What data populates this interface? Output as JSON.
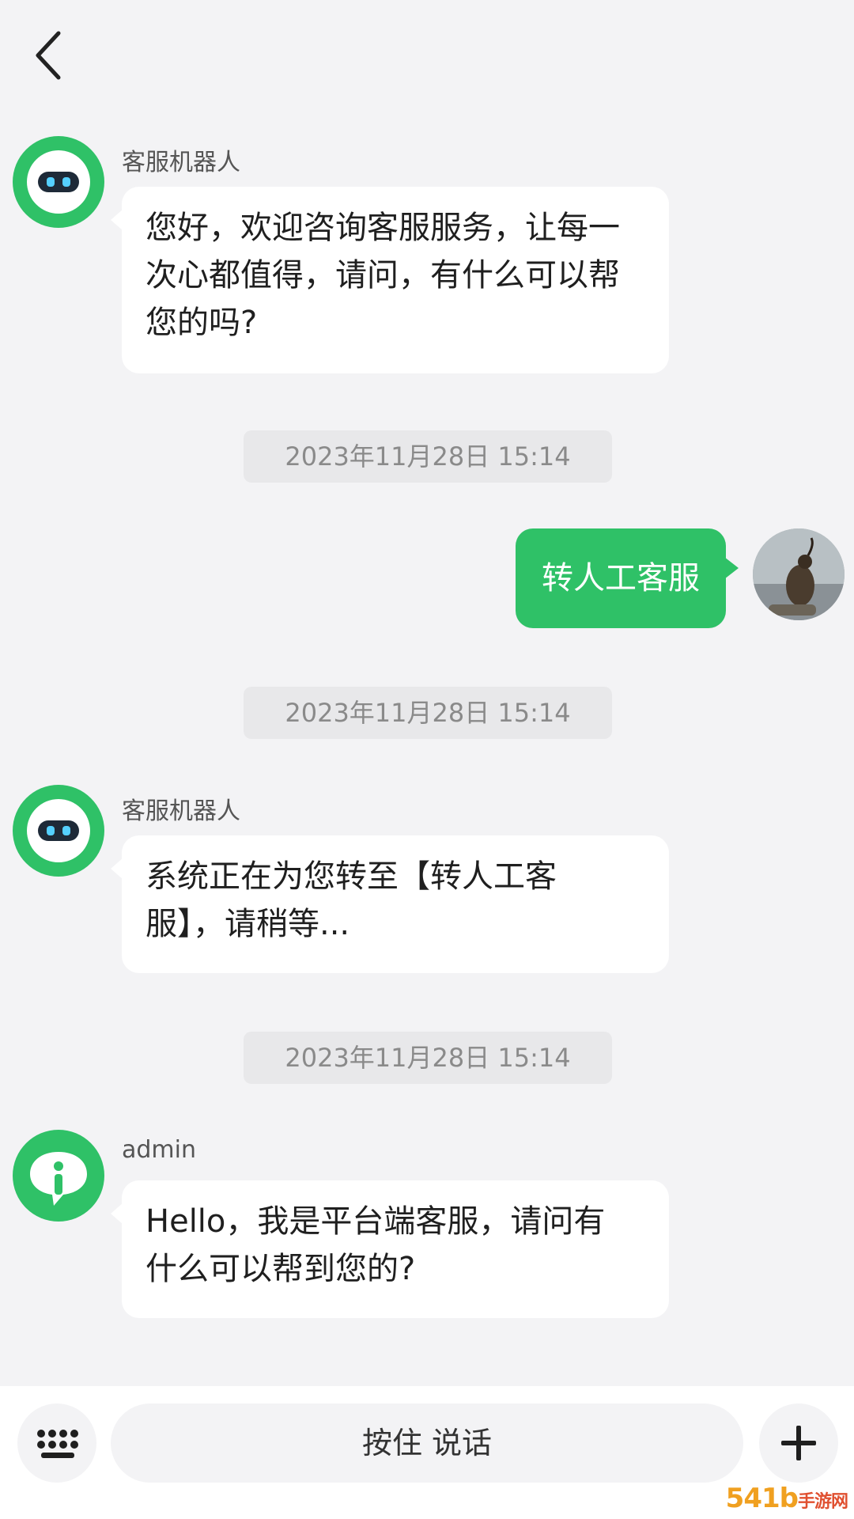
{
  "header": {
    "back_icon": "chevron-left-icon"
  },
  "messages": [
    {
      "type": "incoming",
      "sender": "客服机器人",
      "avatar": "robot-avatar",
      "lines": [
        "您好，欢迎咨询客服服务，让每一",
        "次心都值得，请问，有什么可以帮",
        "您的吗?"
      ]
    },
    {
      "type": "timestamp",
      "text": "2023年11月28日 15:14"
    },
    {
      "type": "outgoing",
      "text": "转人工客服",
      "avatar": "bird-avatar"
    },
    {
      "type": "timestamp",
      "text": "2023年11月28日 15:14"
    },
    {
      "type": "incoming",
      "sender": "客服机器人",
      "avatar": "robot-avatar",
      "lines": [
        "系统正在为您转至【转人工客",
        "服】，请稍等..."
      ]
    },
    {
      "type": "timestamp",
      "text": "2023年11月28日 15:14"
    },
    {
      "type": "incoming",
      "sender": "admin",
      "avatar": "info-avatar",
      "lines": [
        "Hello，我是平台端客服，请问有",
        "什么可以帮到您的?"
      ]
    }
  ],
  "footer": {
    "keyboard_icon": "keyboard-icon",
    "hold_to_talk": "按住 说话",
    "plus_icon": "plus-icon"
  },
  "watermark": {
    "main": "54",
    "mid": "1b",
    "small": "手游网"
  },
  "colors": {
    "accent": "#2fc167",
    "background": "#f3f3f5",
    "bubble": "#ffffff"
  }
}
